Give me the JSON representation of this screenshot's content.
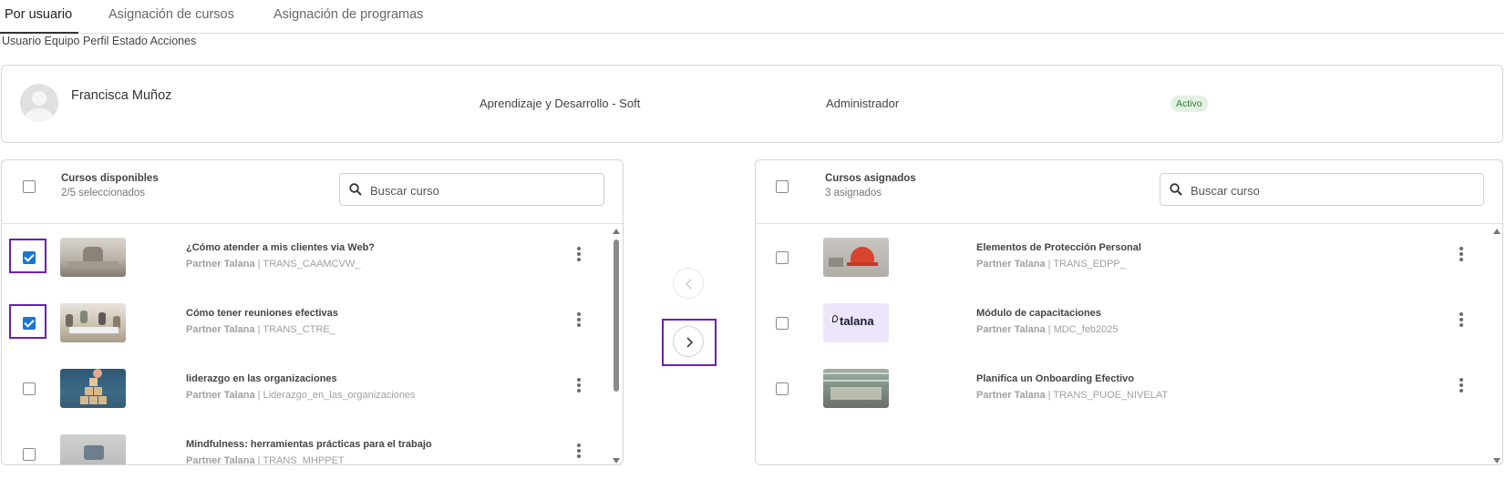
{
  "tabs": [
    {
      "label": "Por usuario",
      "active": true
    },
    {
      "label": "Asignación de cursos",
      "active": false
    },
    {
      "label": "Asignación de programas",
      "active": false
    }
  ],
  "column_headers": "Usuario Equipo Perfil Estado Acciones",
  "user": {
    "name": "Francisca Muñoz",
    "team": "Aprendizaje y Desarrollo - Soft",
    "profile": "Administrador",
    "status": "Activo"
  },
  "available": {
    "title": "Cursos disponibles",
    "subtitle": "2/5 seleccionados",
    "search_placeholder": "Buscar curso",
    "courses": [
      {
        "title": "¿Cómo atender a mis clientes via Web?",
        "partner": "Partner Talana",
        "code": "TRANS_CAAMCVW_",
        "checked": true,
        "thumb_icon": "office-photo-thumbnail"
      },
      {
        "title": "Cómo tener reuniones efectivas",
        "partner": "Partner Talana",
        "code": "TRANS_CTRE_",
        "checked": true,
        "thumb_icon": "meeting-photo-thumbnail"
      },
      {
        "title": "liderazgo en las organizaciones",
        "partner": "Partner Talana",
        "code": "Liderazgo_en_las_organizaciones",
        "checked": false,
        "thumb_icon": "leadership-blocks-thumbnail"
      },
      {
        "title": "Mindfulness: herramientas prácticas para el trabajo",
        "partner": "Partner Talana",
        "code": "TRANS_MHPPET_",
        "checked": false,
        "thumb_icon": "mindfulness-photo-thumbnail"
      }
    ]
  },
  "assigned": {
    "title": "Cursos asignados",
    "subtitle": "3 asignados",
    "search_placeholder": "Buscar curso",
    "courses": [
      {
        "title": "Elementos de Protección Personal",
        "partner": "Partner Talana",
        "code": "TRANS_EDPP_",
        "checked": false,
        "thumb_icon": "safety-helmet-thumbnail"
      },
      {
        "title": "Módulo de capacitaciones",
        "partner": "Partner Talana",
        "code": "MDC_feb2025",
        "checked": false,
        "thumb_icon": "talana-logo-thumbnail",
        "thumb_text": "talana"
      },
      {
        "title": "Planifica un Onboarding Efectivo",
        "partner": "Partner Talana",
        "code": "TRANS_PUOE_NIVELAT",
        "checked": false,
        "thumb_icon": "office-building-thumbnail"
      }
    ]
  },
  "colors": {
    "accent": "#1976d2",
    "highlight": "#6a1fb5",
    "status_bg": "#e3f1e4",
    "status_text": "#2e7d32"
  },
  "icons": {
    "search": "search-icon",
    "move_left": "chevron-left-icon",
    "move_right": "chevron-right-icon",
    "more": "more-vertical-icon"
  }
}
